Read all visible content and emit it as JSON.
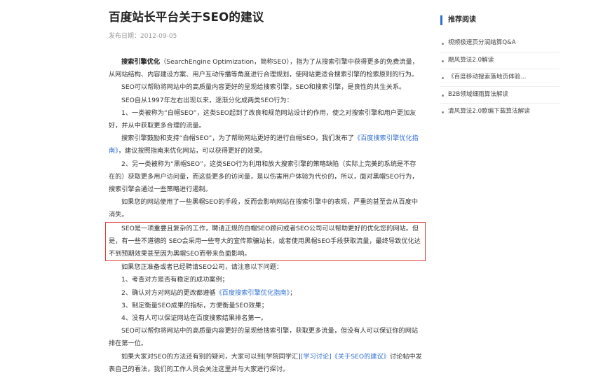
{
  "article": {
    "title": "百度站长平台关于SEO的建议",
    "date_label": "发布日期：",
    "date": "2012-09-05"
  },
  "body": {
    "p1_bold": "搜索引擎优化",
    "p1_rest": "（SearchEngine Optimization，简称SEO），指为了从搜索引擎中获得更多的免费流量，从网站结构、内容建设方案、用户互动传播等角度进行合理规划，使网站更适合搜索引擎的检索原则的行为。",
    "p2": "SEO可以帮助将网站中的高质量内容更好的呈现给搜索引擎，SEO和搜索引擎，是良性的共生关系。",
    "p3": "SEO自从1997年左右出现以来，逐渐分化成两类SEO行为：",
    "p4": "1、一类被称为“白帽SEO”，这类SEO起到了改良和规范网站设计的作用，使之对搜索引擎和用户更加友好，并从中获取更多合理的流量。",
    "p5_a": "搜索引擎鼓励和支持“白帽SEO”，为了帮助网站更好的进行白帽SEO，我们发布了",
    "p5_link": "《百度搜索引擎优化指南》",
    "p5_b": "，建议按照指南来优化网站，可以获得更好的效果。",
    "p6": "2、另一类被称为“黑帽SEO”，这类SEO行为利用和放大搜索引擎的策略缺陷（实际上完美的系统是不存在的）获取更多用户访问量，而这些更多的访问量，是以伤害用户体验为代价的，所以，面对黑帽SEO行为，搜索引擎会通过一些策略进行遏制。",
    "p7": "如果您的网站使用了一些黑帽SEO的手段，反而会影响网站在搜索引擎中的表现，严重的甚至会从百度中消失。",
    "p8": "SEO是一项重要且复杂的工作，聘请正规的白帽SEO顾问或者SEO公司可以帮助更好的优化您的网站。但是，有一些不道德的 SEO会采用一些夸大的宣传欺骗站长，或者使用黑帽SEO手段获取流量，最终导致优化达不到预期效果甚至因为黑帽SEO而带来负面影响。",
    "p9": "如果您正准备或者已经聘请SEO公司，请注意以下问题：",
    "p10": "1、考查对方是否有稳定的成功案例；",
    "p11_a": "2、确认对方对网站的更改都遵循",
    "p11_link": "《百度搜索引擎优化指南》",
    "p11_b": "；",
    "p12": "3、制定衡量SEO成果的指标，方便衡量SEO效果；",
    "p13": "4、没有人可以保证网站在百度搜索结果排名第一。",
    "p14": "SEO可以帮你将网站中的高质量内容更好的呈现给搜索引擎，获取更多流量，但没有人可以保证你的网站排在第一位。",
    "p15_a": "如果大家对SEO的方法还有别的疑问，大家可以到[学院同学汇]",
    "p15_link1": "[学习讨论]",
    "p15_link2": "《关于SEO的建议》",
    "p15_b": "讨论帖中发表自己的看法，我们的工作人员会关注这里并与大家进行探讨。"
  },
  "sidebar": {
    "heading": "推荐阅读",
    "items": [
      {
        "label": "视频极速页分润结算Q&A"
      },
      {
        "label": "飓风算法2.0解读"
      },
      {
        "label": "《百度移动搜索落地页体验..."
      },
      {
        "label": "B2B领域细雨算法解读"
      },
      {
        "label": "清风算法2.0歌编下载算法解读"
      }
    ]
  },
  "colors": {
    "link": "#2f6fd0",
    "highlight_border": "#e23b3b",
    "sidebar_accent": "#2f6fd0"
  }
}
